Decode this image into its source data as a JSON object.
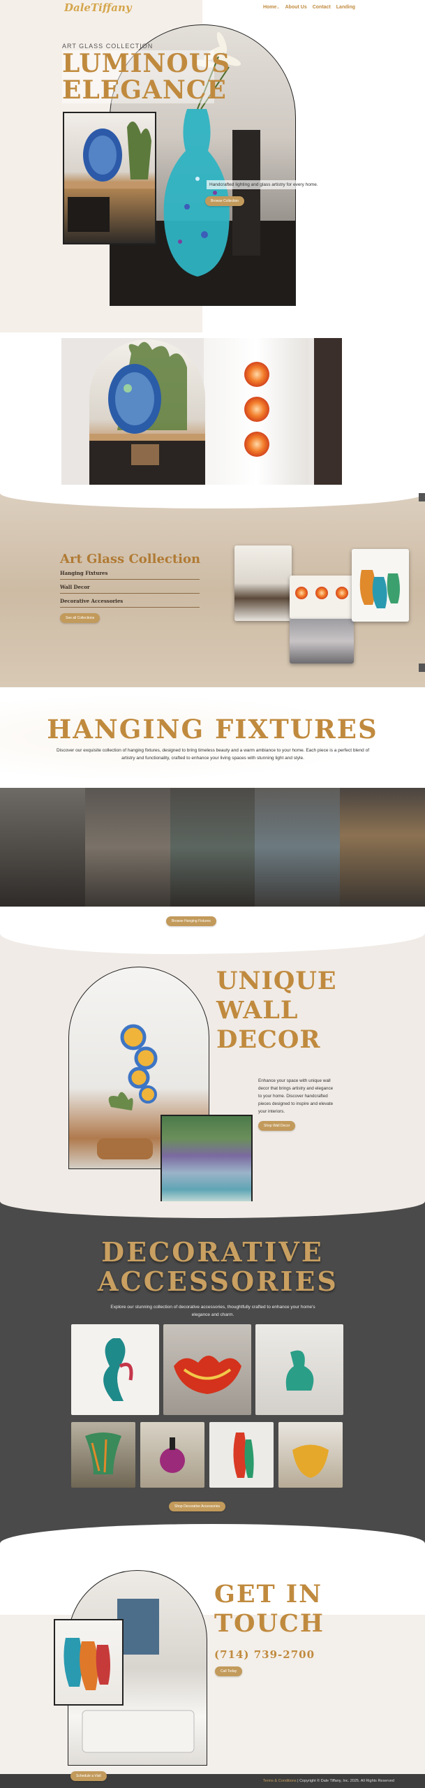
{
  "header": {
    "logo": "DaleTiffany",
    "nav": [
      {
        "label": "Home",
        "caret": "⌄"
      },
      {
        "label": "About Us"
      },
      {
        "label": "Contact"
      },
      {
        "label": "Landing"
      }
    ]
  },
  "hero": {
    "label": "ART GLASS COLLECTION",
    "title": "LUMINOUS ELEGANCE",
    "tagline": "Handcrafted lighting and glass artistry for every home.",
    "button": "Browse Collection"
  },
  "collection": {
    "title": "Art Glass Collection",
    "items": [
      "Hanging Fixtures",
      "Wall Decor",
      "Decorative Accessories"
    ],
    "button": "See all Collections"
  },
  "hanging": {
    "title": "HANGING FIXTURES",
    "description": "Discover our exquisite collection of hanging fixtures, designed to bring timeless beauty and a warm ambiance to your home. Each piece is a perfect blend of artistry and functionality, crafted to enhance your living spaces with stunning light and style.",
    "button": "Browse Hanging Fixtures"
  },
  "wall": {
    "title": "UNIQUE WALL DECOR",
    "description": "Enhance your space with unique wall decor that brings artistry and elegance to your home. Discover handcrafted pieces designed to inspire and elevate your interiors.",
    "button": "Shop Wall Decor"
  },
  "deco": {
    "title": "DECORATIVE ACCESSORIES",
    "description": "Explore our stunning collection of decorative accessories, thoughtfully crafted to enhance your home's elegance and charm.",
    "button": "Shop Decorative Accessories"
  },
  "contact": {
    "title": "GET IN TOUCH",
    "phone": "(714) 739-2700",
    "button": "Call Today",
    "bottom_button": "Schedule a Visit"
  },
  "footer": {
    "link": "Terms & Conditions",
    "copyright": " | Copyright © Dale Tiffany, Inc. 2025. All Rights Reserved"
  },
  "colors": {
    "accent": "#c08a3e",
    "button": "#c29a5b",
    "dark": "#4a4a4a"
  }
}
